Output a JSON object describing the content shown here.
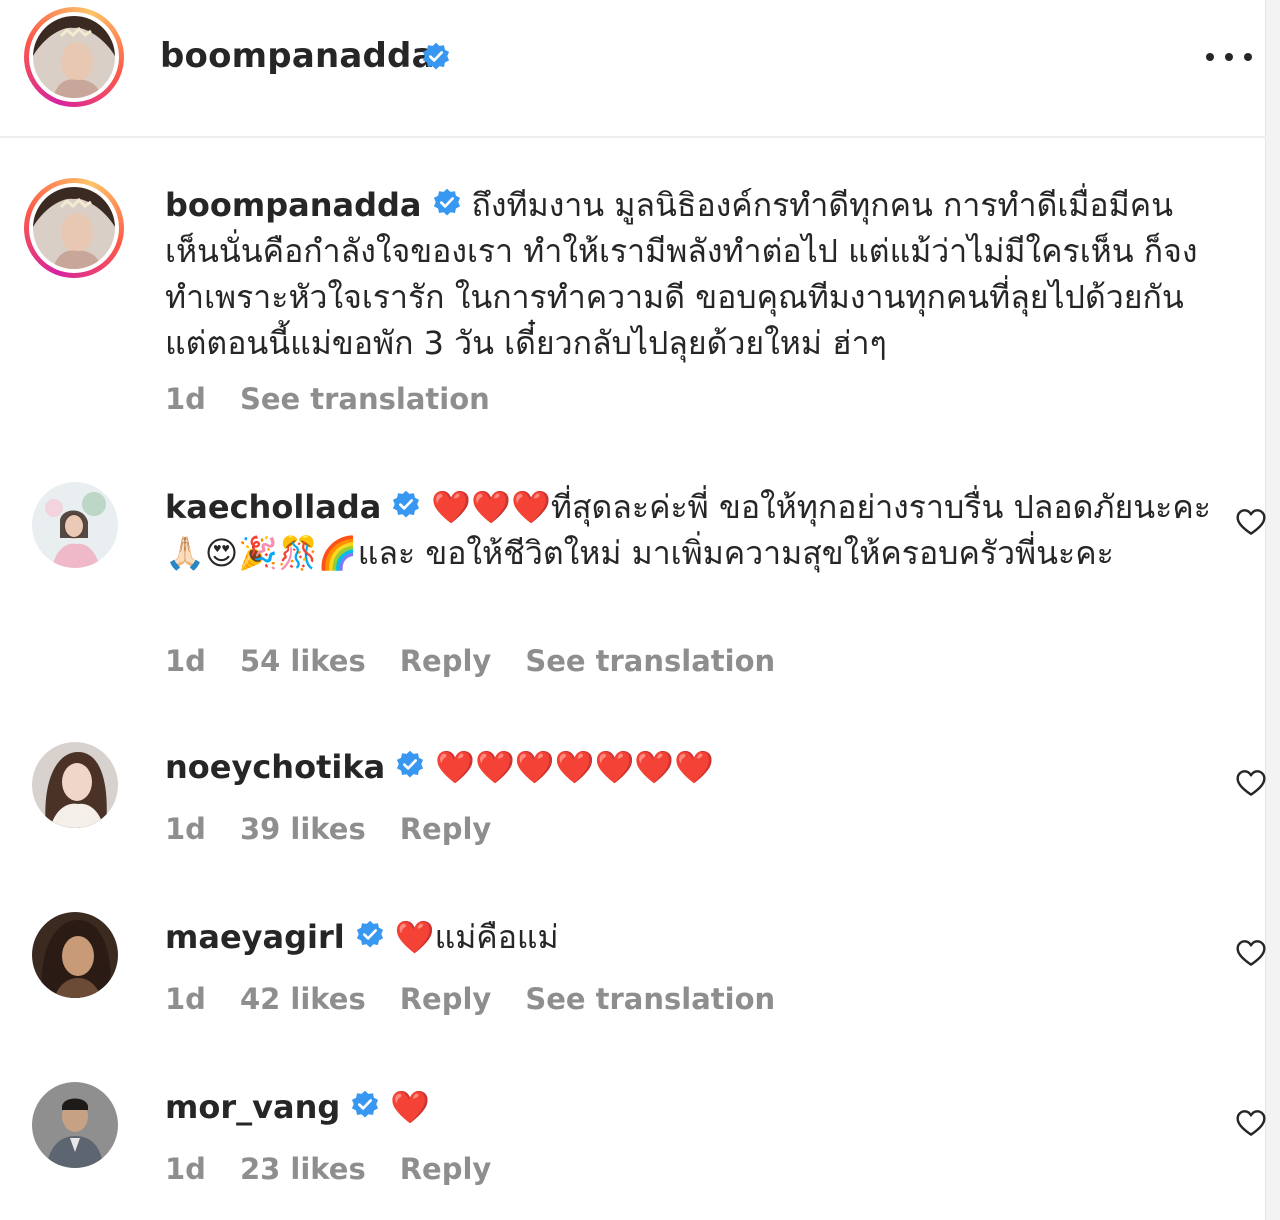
{
  "header": {
    "username": "boompanadda",
    "more_icon": "more-horizontal-icon"
  },
  "caption": {
    "username": "boompanadda",
    "text": "ถึงทีมงาน มูลนิธิองค์กรทำดีทุกคน การทำดีเมื่อมีคนเห็นนั่นคือกำลังใจของเรา ทำให้เรามีพลังทำต่อไป แต่แม้ว่าไม่มีใครเห็น ก็จงทำเพราะหัวใจเรารัก ในการทำความดี ขอบคุณทีมงานทุกคนที่ลุยไปด้วยกัน แต่ตอนนี้แม่ขอพัก 3 วัน เดี๋ยวกลับไปลุยด้วยใหม่ ฮ่าๆ",
    "time": "1d",
    "see_translation": "See translation"
  },
  "comments": [
    {
      "username": "kaechollada",
      "text": "❤️❤️❤️ที่สุดละค่ะพี่ ขอให้ทุกอย่างราบรื่น ปลอดภัยนะคะ 🙏🏻😍🎉🎊🌈และ ขอให้ชีวิตใหม่ มาเพิ่มความสุขให้ครอบครัวพี่นะคะ",
      "time": "1d",
      "likes": "54 likes",
      "reply": "Reply",
      "see_translation": "See translation"
    },
    {
      "username": "noeychotika",
      "text": "❤️❤️❤️❤️❤️❤️❤️",
      "time": "1d",
      "likes": "39 likes",
      "reply": "Reply"
    },
    {
      "username": "maeyagirl",
      "text": "❤️แม่คือแม่",
      "time": "1d",
      "likes": "42 likes",
      "reply": "Reply",
      "see_translation": "See translation"
    },
    {
      "username": "mor_vang",
      "text": "❤️",
      "time": "1d",
      "likes": "23 likes",
      "reply": "Reply"
    }
  ],
  "colors": {
    "verified_blue": "#3897f0",
    "meta_gray": "#8e8e8e",
    "text": "#262626"
  }
}
